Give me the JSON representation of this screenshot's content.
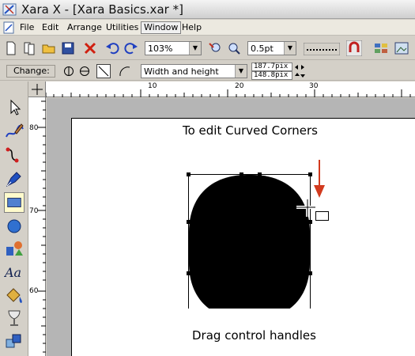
{
  "window": {
    "title": "Xara X - [Xara Basics.xar *]"
  },
  "menu": {
    "items": [
      {
        "label": "File"
      },
      {
        "label": "Edit"
      },
      {
        "label": "Arrange"
      },
      {
        "label": "Utilities"
      },
      {
        "label": "Window",
        "selected": true
      },
      {
        "label": "Help"
      }
    ]
  },
  "toolbar": {
    "zoom_value": "103%",
    "line_width_value": "0.5pt"
  },
  "infobar": {
    "change_label": "Change:",
    "resize_mode": "Width and height",
    "width_value": "187.7pix",
    "height_value": "148.8pix"
  },
  "rulers": {
    "top_labels": [
      "10",
      "20",
      "30"
    ],
    "left_labels": [
      "80",
      "70",
      "60"
    ]
  },
  "canvas": {
    "caption_top": "To edit Curved Corners",
    "caption_bottom": "Drag control handles"
  },
  "colors": {
    "shape_fill": "#000000",
    "arrow": "#d23a1e",
    "active_tool": "#fffbcc"
  },
  "icons": {
    "tools": [
      "selector-tool-icon",
      "freehand-tool-icon",
      "bezier-tool-icon",
      "pen-tool-icon",
      "rectangle-tool-icon",
      "ellipse-tool-icon",
      "shape-tool-icon",
      "text-tool-icon",
      "fill-tool-icon",
      "transparency-tool-icon",
      "mould-tool-icon"
    ]
  }
}
